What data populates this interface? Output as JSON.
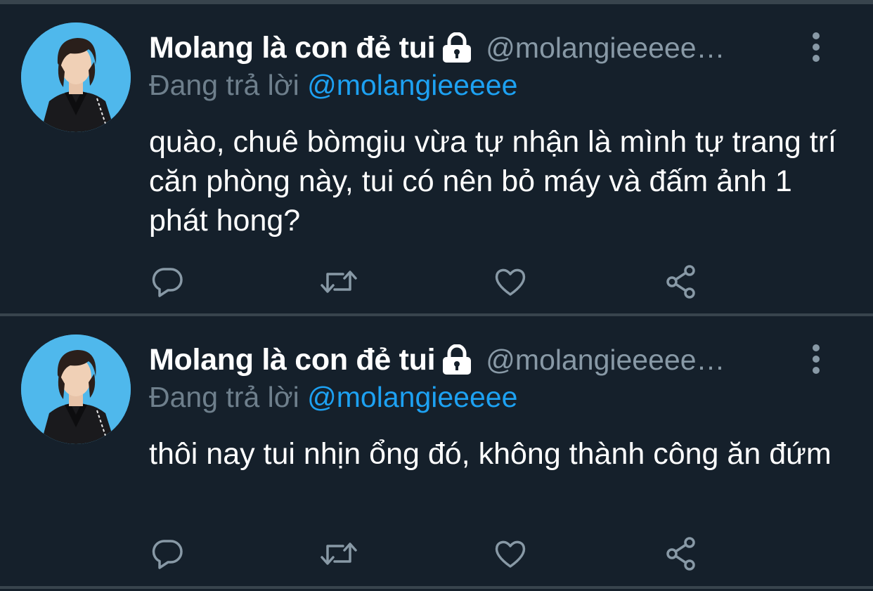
{
  "colors": {
    "background": "#15202b",
    "divider": "#38444d",
    "name": "#ffffff",
    "muted": "#8899a6",
    "link": "#1da1f2",
    "avatar_bg": "#4fb8ec"
  },
  "tweets": [
    {
      "author_name": "Molang là con đẻ tui",
      "locked_icon": "lock-icon",
      "handle": "@molangieeeeeeeeee",
      "replying_prefix": "Đang trả lời",
      "replying_to": "@molangieeeee",
      "text": "quào, chuê bòmgiu vừa tự nhận là mình tự trang trí căn phòng này, tui có nên bỏ máy và đấm ảnh 1 phát hong?",
      "actions": [
        "reply-icon",
        "retweet-icon",
        "like-icon",
        "share-icon"
      ]
    },
    {
      "author_name": "Molang là con đẻ tui",
      "locked_icon": "lock-icon",
      "handle": "@molangieeeeeeeeee",
      "replying_prefix": "Đang trả lời",
      "replying_to": "@molangieeeee",
      "text": "thôi nay tui nhịn ổng đó, không thành công ăn đứm",
      "actions": [
        "reply-icon",
        "retweet-icon",
        "like-icon",
        "share-icon"
      ]
    }
  ]
}
